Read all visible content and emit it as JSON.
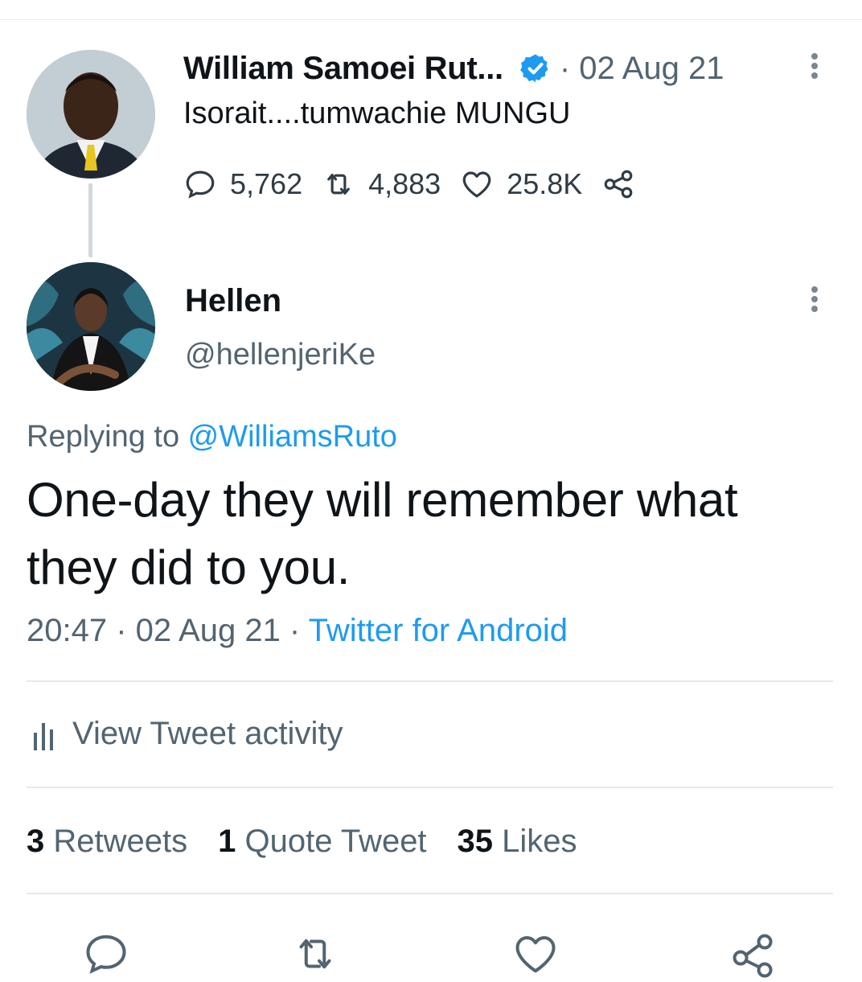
{
  "parent": {
    "name": "William Samoei Rut...",
    "time": "· 02 Aug 21",
    "text": "Isorait....tumwachie MUNGU",
    "replies": "5,762",
    "retweets": "4,883",
    "likes": "25.8K"
  },
  "reply": {
    "name": "Hellen",
    "handle": "@hellenjeriKe",
    "replying_label": "Replying to ",
    "replying_to": "@WilliamsRuto",
    "text": "One-day they will remember what they did to you.",
    "timestamp": "20:47 · 02 Aug 21 · ",
    "source": "Twitter for Android"
  },
  "activity_label": "View Tweet activity",
  "stats": {
    "retweets_count": "3",
    "retweets_label": " Retweets",
    "quotes_count": "1",
    "quotes_label": " Quote Tweet",
    "likes_count": "35",
    "likes_label": " Likes"
  },
  "colors": {
    "accent": "#1d9bf0",
    "text": "#0f1419",
    "secondary": "#536471",
    "border": "#e6e9ec"
  }
}
